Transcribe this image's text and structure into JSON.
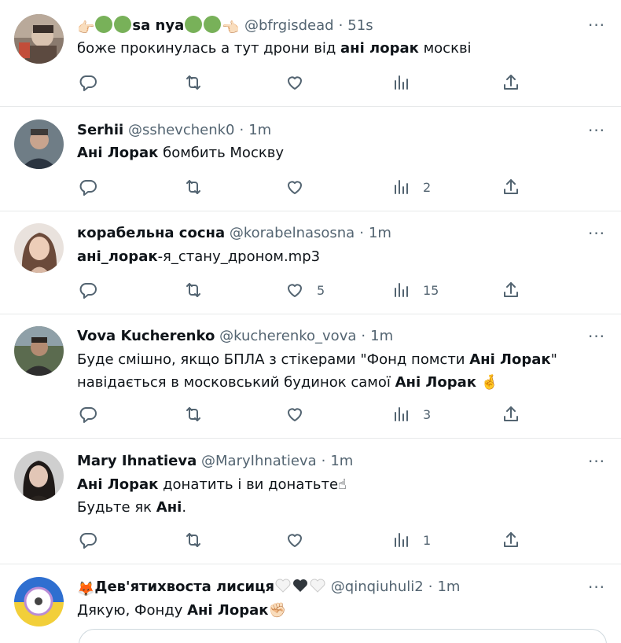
{
  "tweets": [
    {
      "name_parts": [
        "sa nya"
      ],
      "handle": "@bfrgisdead",
      "time": "51s",
      "segments": [
        {
          "t": "боже прокинулась а тут дрони від ",
          "b": false
        },
        {
          "t": "ані лорак",
          "b": true
        },
        {
          "t": " москві",
          "b": false
        }
      ],
      "counts": {
        "reply": "",
        "retweet": "",
        "like": "",
        "views": ""
      }
    },
    {
      "name": "Serhii",
      "handle": "@sshevchenk0",
      "time": "1m",
      "segments": [
        {
          "t": "Ані Лорак",
          "b": true
        },
        {
          "t": " бомбить Москву",
          "b": false
        }
      ],
      "counts": {
        "reply": "",
        "retweet": "",
        "like": "",
        "views": "2"
      }
    },
    {
      "name": "корабельна сосна",
      "handle": "@korabelnasosna",
      "time": "1m",
      "segments": [
        {
          "t": "ані_лорак",
          "b": true
        },
        {
          "t": "-я_стану_дроном.mp3",
          "b": false
        }
      ],
      "counts": {
        "reply": "",
        "retweet": "",
        "like": "5",
        "views": "15"
      }
    },
    {
      "name": "Vova Kucherenko",
      "handle": "@kucherenko_vova",
      "time": "1m",
      "segments": [
        {
          "t": "Буде смішно, якщо БПЛА з стікерами \"Фонд помсти ",
          "b": false
        },
        {
          "t": "Ані Лорак",
          "b": true
        },
        {
          "t": "\"\nнавідається в московський будинок самої ",
          "b": false
        },
        {
          "t": "Ані Лорак",
          "b": true
        },
        {
          "t": " 🤞",
          "b": false
        }
      ],
      "counts": {
        "reply": "",
        "retweet": "",
        "like": "",
        "views": "3"
      }
    },
    {
      "name": "Mary Ihnatieva",
      "handle": "@MaryIhnatieva",
      "time": "1m",
      "segments": [
        {
          "t": "Ані Лорак",
          "b": true
        },
        {
          "t": " донатить і ви донатьте☝\nБудьте як ",
          "b": false
        },
        {
          "t": "Ані",
          "b": true
        },
        {
          "t": ".",
          "b": false
        }
      ],
      "counts": {
        "reply": "",
        "retweet": "",
        "like": "",
        "views": "1"
      }
    },
    {
      "name": "Дев'ятихвоста лисиця",
      "name_prefix": "🦊",
      "handle": "@qinqiuhuli2",
      "time": "1m",
      "segments": [
        {
          "t": "Дякую, Фонду ",
          "b": false
        },
        {
          "t": "Ані Лорак",
          "b": true
        },
        {
          "t": "✊🏻",
          "b": false
        }
      ],
      "counts": {
        "reply": "",
        "retweet": "",
        "like": "",
        "views": ""
      }
    }
  ],
  "icons": [
    "reply-icon",
    "retweet-icon",
    "like-icon",
    "views-icon",
    "share-icon",
    "more-icon"
  ],
  "colors": {
    "text": "#0f1419",
    "secondary": "#536471",
    "divider": "#e7e9ea",
    "emoji_green": "#78b159"
  }
}
